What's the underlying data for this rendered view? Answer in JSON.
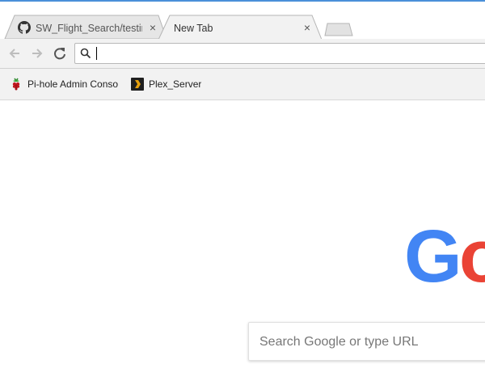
{
  "tabs": [
    {
      "title": "SW_Flight_Search/testing",
      "favicon": "github-icon",
      "active": false
    },
    {
      "title": "New Tab",
      "favicon": "",
      "active": true
    }
  ],
  "tab_close_glyph": "×",
  "toolbar": {
    "back_icon": "arrow-left-icon",
    "forward_icon": "arrow-right-icon",
    "reload_icon": "reload-icon",
    "omnibox_value": ""
  },
  "bookmarks": [
    {
      "label": "Pi-hole Admin Console",
      "icon": "raspberry-icon"
    },
    {
      "label": "Plex_Server",
      "icon": "plex-icon"
    }
  ],
  "ntp": {
    "search_placeholder": "Search Google or type URL",
    "logo_letters": [
      "G",
      "o"
    ]
  },
  "colors": {
    "google_blue": "#4285f4",
    "google_red": "#ea4335",
    "accent_line": "#4a90d9"
  }
}
